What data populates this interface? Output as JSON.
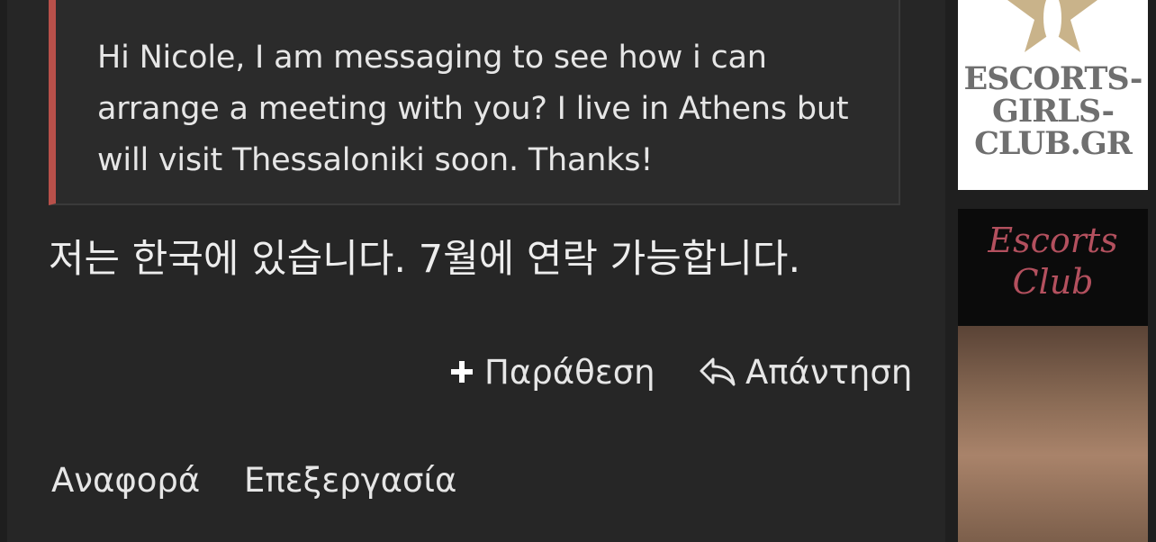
{
  "post": {
    "quote_text": "Hi Nicole, I am messaging to see how i can arrange a meeting with you? I live in Athens but will visit Thessaloniki soon. Thanks!",
    "message_text": "저는 한국에 있습니다. 7월에 연락 가능합니다.",
    "quote_button_label": "Παράθεση",
    "reply_button_label": "Απάντηση",
    "report_label": "Αναφορά",
    "edit_label": "Επεξεργασία"
  },
  "sidebar": {
    "ad1": {
      "line1": "ESCORTS-",
      "line2": "GIRLS-",
      "line3": "CLUB.GR"
    },
    "ad2": {
      "line1": "Escorts",
      "line2": "Club"
    }
  },
  "colors": {
    "background": "#242424",
    "quote_accent": "#b8504a",
    "text": "#e6e6e6",
    "ad_script": "#b3505e"
  }
}
